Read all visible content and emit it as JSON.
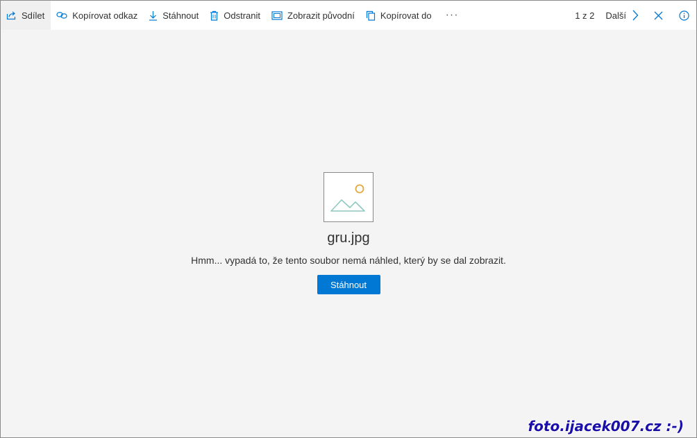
{
  "toolbar": {
    "share": "Sdílet",
    "copy_link": "Kopírovat odkaz",
    "download": "Stáhnout",
    "delete": "Odstranit",
    "view_original": "Zobrazit původní",
    "copy_to": "Kopírovat do",
    "more": "···",
    "pager": "1 z 2",
    "next": "Další"
  },
  "preview": {
    "filename": "gru.jpg",
    "message": "Hmm... vypadá to, že tento soubor nemá náhled, který by se dal zobrazit.",
    "download_button": "Stáhnout"
  },
  "watermark": "foto.ijacek007.cz :-)",
  "colors": {
    "accent": "#0078d4",
    "sun": "#e2a93a",
    "mountain": "#8fc9bf"
  }
}
